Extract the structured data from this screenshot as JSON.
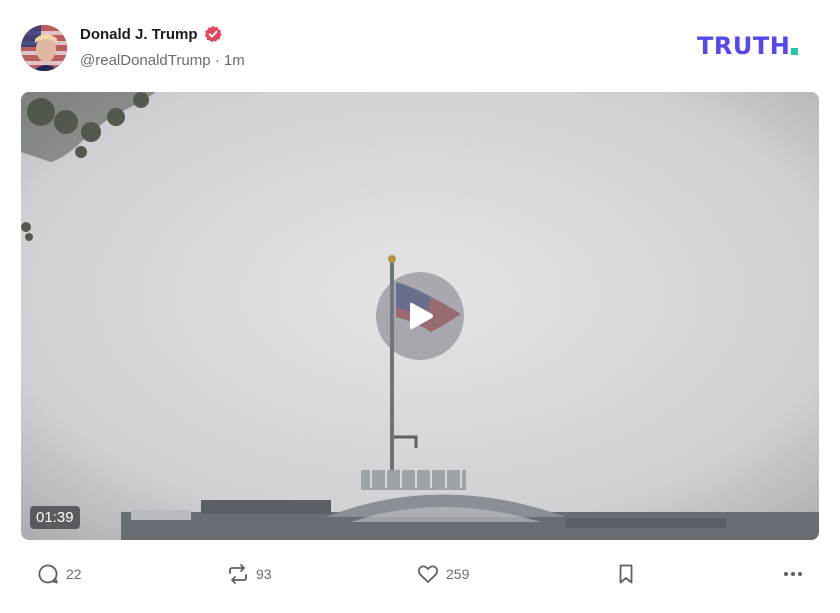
{
  "post": {
    "display_name": "Donald J. Trump",
    "handle": "@realDonaldTrump",
    "separator": "·",
    "time_ago": "1m",
    "verified": true
  },
  "brand": {
    "logo_text": "TRUTH",
    "logo_color": "#5448ee",
    "logo_dot_color": "#20c7a8"
  },
  "media": {
    "type": "video",
    "duration": "01:39"
  },
  "actions": {
    "replies": "22",
    "retruths": "93",
    "likes": "259"
  },
  "icons": {
    "reply": "reply-icon",
    "retruth": "retruth-icon",
    "like": "heart-icon",
    "bookmark": "bookmark-icon",
    "more": "more-icon",
    "play": "play-icon",
    "verified": "verified-badge-icon"
  },
  "colors": {
    "verified": "#e3475b",
    "text_secondary": "#6b6b76"
  }
}
